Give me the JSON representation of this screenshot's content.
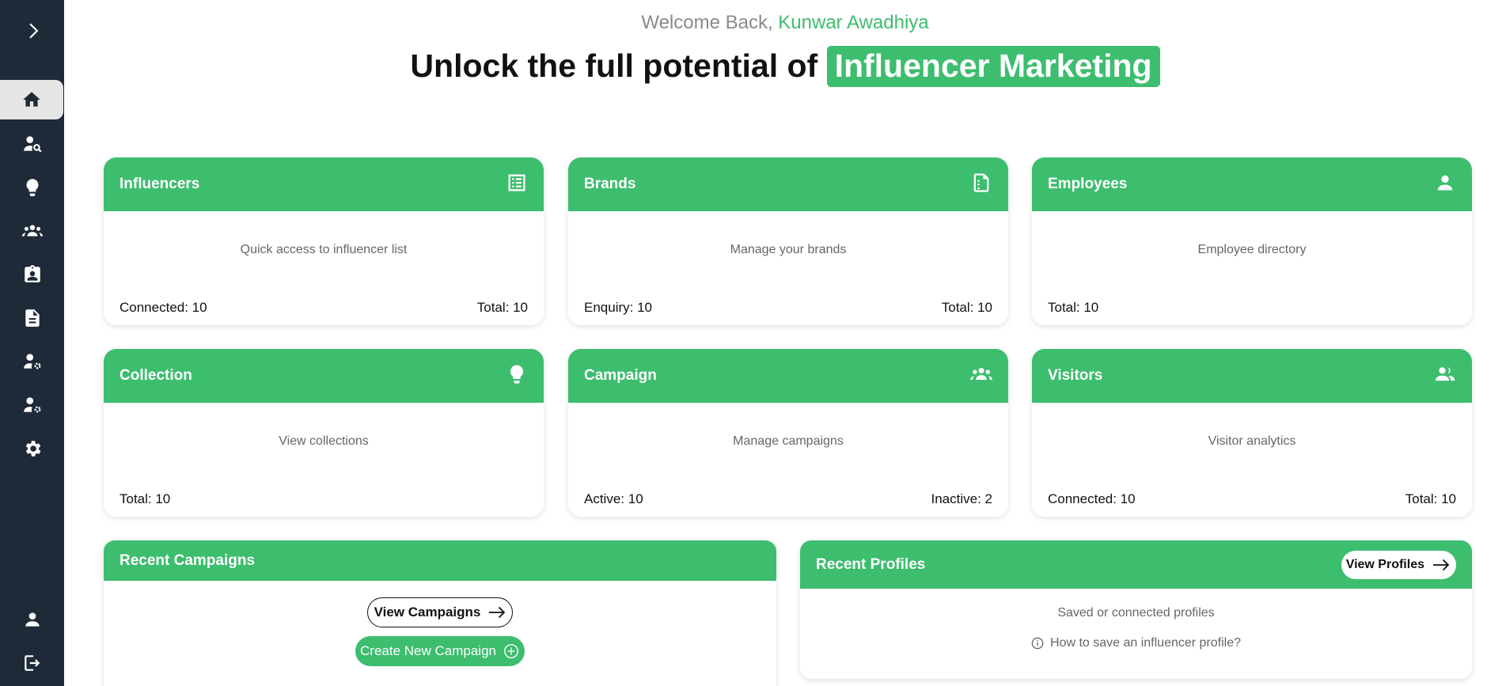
{
  "sidebar": {
    "items": [
      {
        "icon": "chevron-right-icon"
      },
      {
        "icon": "home-icon"
      },
      {
        "icon": "user-search-icon"
      },
      {
        "icon": "lightbulb-icon"
      },
      {
        "icon": "group-icon"
      },
      {
        "icon": "badge-icon"
      },
      {
        "icon": "document-icon"
      },
      {
        "icon": "user-settings-icon"
      },
      {
        "icon": "user-settings-icon"
      },
      {
        "icon": "gear-icon"
      },
      {
        "icon": "person-icon"
      },
      {
        "icon": "logout-icon"
      }
    ]
  },
  "header": {
    "welcome_prefix": "Welcome Back, ",
    "user_name": "Kunwar Awadhiya",
    "headline_prefix": "Unlock the full potential of ",
    "headline_highlight": "Influencer Marketing"
  },
  "cards": [
    {
      "title": "Influencers",
      "icon": "list-icon",
      "description": "Quick access to influencer list",
      "left": "Connected: 10",
      "right": "Total: 10"
    },
    {
      "title": "Brands",
      "icon": "file-icon",
      "description": "Manage your brands",
      "left": "Enquiry: 10",
      "right": "Total: 10"
    },
    {
      "title": "Employees",
      "icon": "person-icon",
      "description": "Employee directory",
      "left": "Total: 10",
      "right": ""
    },
    {
      "title": "Collection",
      "icon": "lightbulb-icon",
      "description": "View collections",
      "left": "Total: 10",
      "right": ""
    },
    {
      "title": "Campaign",
      "icon": "group-icon",
      "description": "Manage campaigns",
      "left": "Active: 10",
      "right": "Inactive: 2"
    },
    {
      "title": "Visitors",
      "icon": "people-icon",
      "description": "Visitor analytics",
      "left": "Connected: 10",
      "right": "Total: 10"
    }
  ],
  "recent_campaigns": {
    "title": "Recent Campaigns",
    "view_label": "View Campaigns",
    "create_label": "Create New Campaign"
  },
  "recent_profiles": {
    "title": "Recent Profiles",
    "view_label": "View Profiles",
    "subtitle": "Saved or connected profiles",
    "help_text": "How to save an influencer profile?"
  },
  "colors": {
    "accent": "#3dbd6e",
    "sidebar": "#1e2a38"
  }
}
